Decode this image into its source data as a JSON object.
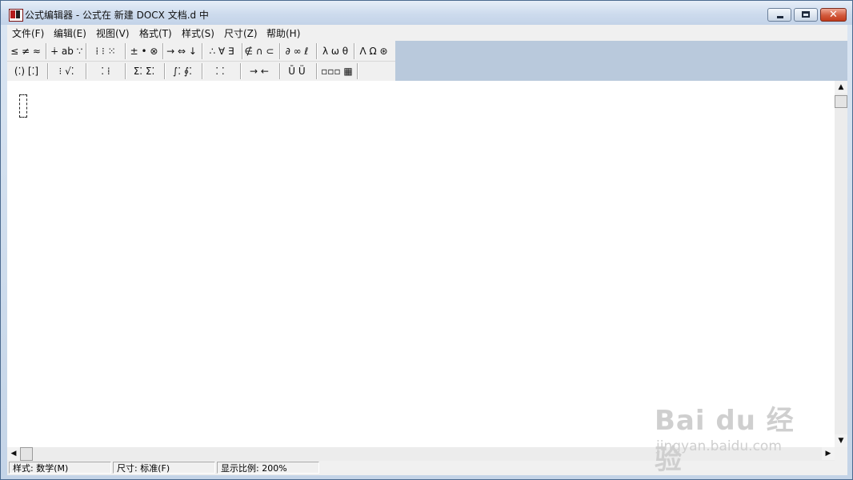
{
  "window": {
    "title": "公式编辑器 - 公式在 新建 DOCX 文档.d 中",
    "controls": {
      "minimize_icon": "minimize-icon",
      "maximize_icon": "maximize-icon",
      "close_glyph": "✕"
    }
  },
  "menu": {
    "items": [
      {
        "label": "文件(F)"
      },
      {
        "label": "编辑(E)"
      },
      {
        "label": "视图(V)"
      },
      {
        "label": "格式(T)"
      },
      {
        "label": "样式(S)"
      },
      {
        "label": "尺寸(Z)"
      },
      {
        "label": "帮助(H)"
      }
    ]
  },
  "palette": {
    "row1": [
      {
        "glyphs": "≤ ≠ ≈"
      },
      {
        "glyphs": "∔ ab ∵"
      },
      {
        "glyphs": "⁞ ⁝ ⁙"
      },
      {
        "glyphs": "± • ⊗"
      },
      {
        "glyphs": "→ ⇔ ↓"
      },
      {
        "glyphs": "∴ ∀ ∃"
      },
      {
        "glyphs": "∉ ∩ ⊂"
      },
      {
        "glyphs": "∂ ∞ ℓ"
      },
      {
        "glyphs": "λ ω θ"
      },
      {
        "glyphs": "Λ Ω ⊛"
      }
    ],
    "row2": [
      {
        "glyphs": "(⁚) [⁚]"
      },
      {
        "glyphs": "⁝ √⁚"
      },
      {
        "glyphs": "⁚ ⁞"
      },
      {
        "glyphs": "Σ⁚ Σ⁚"
      },
      {
        "glyphs": "∫⁚ ∮⁚"
      },
      {
        "glyphs": "⁚ ⁚"
      },
      {
        "glyphs": "→ ←"
      },
      {
        "glyphs": "Ū Ü"
      },
      {
        "glyphs": "▫▫▫ ▦"
      }
    ]
  },
  "scrollbars": {
    "up_arrow": "▲",
    "down_arrow": "▼",
    "left_arrow": "◀",
    "right_arrow": "▶"
  },
  "status": {
    "style": "样式: 数学(M)",
    "size": "尺寸: 标准(F)",
    "zoom": "显示比例: 200%"
  },
  "watermark": {
    "logo": "Bai du 经验",
    "url": "jingyan.baidu.com"
  }
}
